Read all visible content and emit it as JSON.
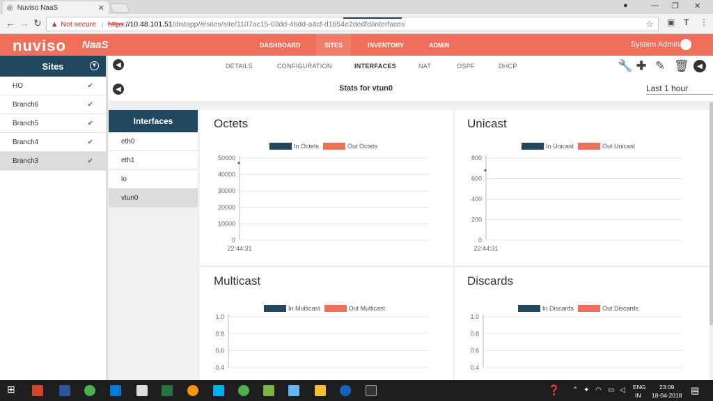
{
  "browser": {
    "tab_title": "Nuviso NaaS",
    "not_secure": "Not secure",
    "url_scheme": "https",
    "url_host": "://10.48.101.51",
    "url_path": "/distapp/#/sites/site/1107ac15-03dd-46dd-a4cf-d1654e2dedfd/interfaces"
  },
  "app": {
    "logo": "nuviso",
    "product": "NaaS",
    "nav": [
      "DASHBOARD",
      "SITES",
      "INVENTORY",
      "ADMIN"
    ],
    "user": "System Admin"
  },
  "sites": {
    "title": "Sites",
    "items": [
      {
        "name": "HO"
      },
      {
        "name": "Branch6"
      },
      {
        "name": "Branch5"
      },
      {
        "name": "Branch4"
      },
      {
        "name": "Branch3"
      }
    ]
  },
  "subnav": {
    "tabs": [
      "DETAILS",
      "CONFIGURATION",
      "INTERFACES",
      "NAT",
      "OSPF",
      "DHCP"
    ]
  },
  "stats": {
    "title": "Stats for vtun0",
    "range": "Last 1 hour"
  },
  "interfaces": {
    "title": "Interfaces",
    "items": [
      "eth0",
      "eth1",
      "lo",
      "vtun0"
    ]
  },
  "colors": {
    "in": "#21485f",
    "out": "#ef6f5b",
    "accent": "#ef6f5b",
    "header": "#21485f"
  },
  "charts": {
    "octets": {
      "title": "Octets",
      "in_label": "In Octets",
      "out_label": "Out Octets"
    },
    "unicast": {
      "title": "Unicast",
      "in_label": "In Unicast",
      "out_label": "Out Unicast"
    },
    "multicast": {
      "title": "Multicast",
      "in_label": "In Multicast",
      "out_label": "Out Multicast"
    },
    "discards": {
      "title": "Discards",
      "in_label": "In Discards",
      "out_label": "Out Discards"
    }
  },
  "chart_data": [
    {
      "type": "line",
      "title": "Octets",
      "series": [
        {
          "name": "In Octets",
          "values": [
            47000
          ]
        },
        {
          "name": "Out Octets",
          "values": []
        }
      ],
      "x": [
        "22:44:31"
      ],
      "yticks": [
        "0",
        "10000",
        "20000",
        "30000",
        "40000",
        "50000"
      ],
      "ylim": [
        0,
        50000
      ]
    },
    {
      "type": "line",
      "title": "Unicast",
      "series": [
        {
          "name": "In Unicast",
          "values": [
            680
          ]
        },
        {
          "name": "Out Unicast",
          "values": []
        }
      ],
      "x": [
        "22:44:31"
      ],
      "yticks": [
        "0",
        "200",
        "400",
        "600",
        "800"
      ],
      "ylim": [
        0,
        800
      ]
    },
    {
      "type": "line",
      "title": "Multicast",
      "series": [
        {
          "name": "In Multicast",
          "values": []
        },
        {
          "name": "Out Multicast",
          "values": []
        }
      ],
      "yticks": [
        "0.4",
        "0.6",
        "0.8",
        "1.0"
      ]
    },
    {
      "type": "line",
      "title": "Discards",
      "series": [
        {
          "name": "In Discards",
          "values": []
        },
        {
          "name": "Out Discards",
          "values": []
        }
      ],
      "yticks": [
        "0.4",
        "0.6",
        "0.8",
        "1.0"
      ]
    }
  ],
  "taskbar": {
    "lang1": "ENG",
    "lang2": "IN",
    "time": "23:09",
    "date": "18-04-2018"
  }
}
